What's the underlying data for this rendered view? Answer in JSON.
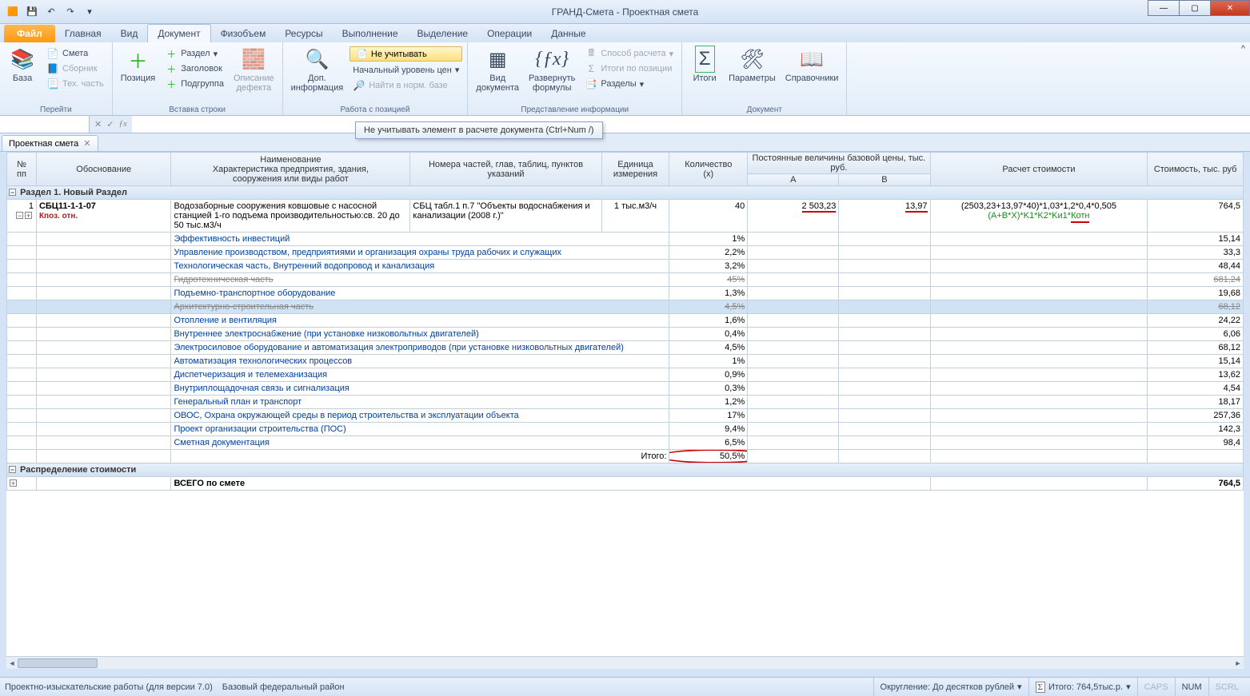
{
  "app_title": "ГРАНД-Смета - Проектная смета",
  "tabs": {
    "file": "Файл",
    "items": [
      "Главная",
      "Вид",
      "Документ",
      "Физобъем",
      "Ресурсы",
      "Выполнение",
      "Выделение",
      "Операции",
      "Данные"
    ],
    "active": "Документ"
  },
  "ribbon": {
    "group_perejti": {
      "label": "Перейти",
      "baza": "База",
      "smeta": "Смета",
      "sbornik": "Сборник",
      "teh": "Тех. часть"
    },
    "group_vstavka": {
      "label": "Вставка строки",
      "poz": "Позиция",
      "razdel": "Раздел",
      "zagolovok": "Заголовок",
      "podgruppa": "Подгруппа",
      "opis": "Описание\nдефекта"
    },
    "group_rabota": {
      "label": "Работа с позицией",
      "dop": "Доп.\nинформация",
      "neuchit": "Не учитывать",
      "uroven": "Начальный уровень цен",
      "najti": "Найти в норм. базе"
    },
    "group_predstav": {
      "label": "Представление информации",
      "vid": "Вид\nдокумента",
      "razvern": "Развернуть\nформулы",
      "sposob": "Способ расчета",
      "itogi_pos": "Итоги по позиции",
      "razdely": "Разделы"
    },
    "group_dokument": {
      "label": "Документ",
      "itogi": "Итоги",
      "param": "Параметры",
      "sprav": "Справочники"
    }
  },
  "tooltip": "Не учитывать элемент в расчете документа (Ctrl+Num /)",
  "doc_tab": "Проектная смета",
  "columns": {
    "npp": "№\nпп",
    "obosn": "Обоснование",
    "naim": "Наименование\nХарактеристика предприятия, здания,\nсооружения или виды работ",
    "nomera": "Номера частей, глав, таблиц, пунктов\nуказаний",
    "ed": "Единица\nизмерения",
    "kol": "Количество\n(x)",
    "post": "Постоянные величины базовой цены, тыс.\nруб.",
    "A": "A",
    "B": "B",
    "rasch": "Расчет стоимости",
    "stoim": "Стоимость, тыс. руб"
  },
  "section1": "Раздел 1. Новый Раздел",
  "main_item": {
    "num": "1",
    "code": "СБЦ11-1-1-07",
    "kpoz": "Кпоз. отн.",
    "name": "Водозаборные сооружения ковшовые с насосной станцией 1-го подъема производительностью:св. 20 до 50 тыс.м3/ч",
    "tabl": "СБЦ табл.1 п.7 \"Объекты водоснабжения и канализации (2008 г.)\"",
    "unit": "1 тыс.м3/ч",
    "qty": "40",
    "A": "2 503,23",
    "B": "13,97",
    "formula": "(2503,23+13,97*40)*1,03*1,2*0,4*0,505",
    "formula2": "(A+B*X)*K1*K2*Kи1*Котн",
    "cost": "764,5"
  },
  "sub_items": [
    {
      "name": "Эффективность инвестиций",
      "pct": "1%",
      "cost": "15,14"
    },
    {
      "name": "Управление производством, предприятиями и организация охраны труда рабочих и служащих",
      "pct": "2,2%",
      "cost": "33,3"
    },
    {
      "name": "Технологическая часть, Внутренний водопровод и канализация",
      "pct": "3,2%",
      "cost": "48,44"
    },
    {
      "name": "Гидротехническая часть",
      "pct": "45%",
      "cost": "681,24",
      "strike": true
    },
    {
      "name": "Подъемно-транспортное оборудование",
      "pct": "1,3%",
      "cost": "19,68"
    },
    {
      "name": "Архитектурно-строительная часть",
      "pct": "4,5%",
      "cost": "68,12",
      "strike": true,
      "selected": true
    },
    {
      "name": "Отопление и вентиляция",
      "pct": "1,6%",
      "cost": "24,22"
    },
    {
      "name": "Внутреннее электроснабжение (при установке низковольтных двигателей)",
      "pct": "0,4%",
      "cost": "6,06"
    },
    {
      "name": "Электросиловое оборудование и автоматизация электроприводов (при установке низковольтных двигателей)",
      "pct": "4,5%",
      "cost": "68,12"
    },
    {
      "name": "Автоматизация технологических процессов",
      "pct": "1%",
      "cost": "15,14"
    },
    {
      "name": "Диспетчеризация и телемеханизация",
      "pct": "0,9%",
      "cost": "13,62"
    },
    {
      "name": "Внутриплощадочная связь и сигнализация",
      "pct": "0,3%",
      "cost": "4,54"
    },
    {
      "name": "Генеральный план и транспорт",
      "pct": "1,2%",
      "cost": "18,17"
    },
    {
      "name": "ОВОС, Охрана окружающей среды в период строительства и эксплуатации объекта",
      "pct": "17%",
      "cost": "257,36"
    },
    {
      "name": "Проект организации строительства (ПОС)",
      "pct": "9,4%",
      "cost": "142,3"
    },
    {
      "name": "Сметная документация",
      "pct": "6,5%",
      "cost": "98,4"
    }
  ],
  "itogo": {
    "label": "Итого:",
    "pct": "50,5%"
  },
  "raspred": "Распределение стоимости",
  "vsego": {
    "label": "ВСЕГО по смете",
    "cost": "764,5"
  },
  "status": {
    "left1": "Проектно-изыскательские работы (для версии 7.0)",
    "left2": "Базовый федеральный район",
    "okrug": "Округление: До десятков рублей",
    "itogo": "Итого: 764,5тыс.р.",
    "caps": "CAPS",
    "num": "NUM",
    "scrl": "SCRL"
  }
}
